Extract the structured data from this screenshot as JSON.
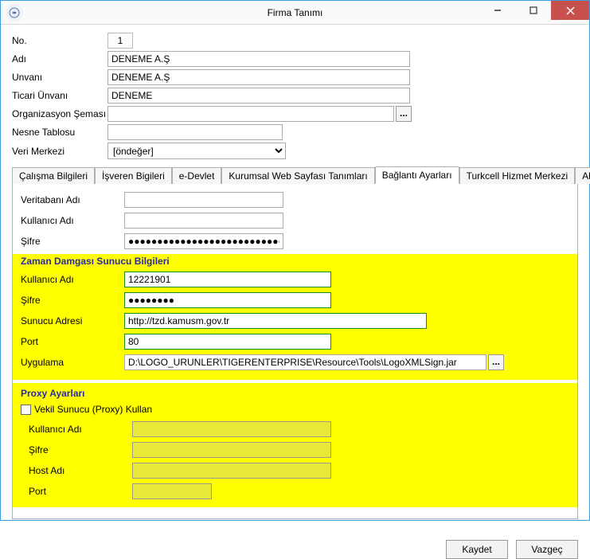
{
  "window": {
    "title": "Firma Tanımı"
  },
  "top": {
    "no_lbl": "No.",
    "no_val": "1",
    "adi_lbl": "Adı",
    "adi_val": "DENEME A.Ş",
    "unvani_lbl": "Unvanı",
    "unvani_val": "DENEME A.Ş",
    "ticari_lbl": "Ticari Ünvanı",
    "ticari_val": "DENEME",
    "org_lbl": "Organizasyon Şeması",
    "org_val": "",
    "nesne_lbl": "Nesne Tablosu",
    "nesne_val": "",
    "veri_lbl": "Veri Merkezi",
    "veri_val": "[öndeğer]"
  },
  "tabs": {
    "t0": "Çalışma Bilgileri",
    "t1": "İşveren Bigileri",
    "t2": "e-Devlet",
    "t3": "Kurumsal Web Sayfası Tanımları",
    "t4": "Bağlantı Ayarları",
    "t5": "Turkcell Hizmet Merkezi",
    "t6": "Akıllı Fax Ayarları"
  },
  "db": {
    "vt_lbl": "Veritabanı Adı",
    "vt_val": "",
    "ku_lbl": "Kullanıcı Adı",
    "ku_val": "",
    "sf_lbl": "Şifre",
    "sf_val": "●●●●●●●●●●●●●●●●●●●●●●●●●●●●●●●●"
  },
  "ts": {
    "title": "Zaman Damgası Sunucu Bilgileri",
    "ku_lbl": "Kullanıcı Adı",
    "ku_val": "12221901",
    "sf_lbl": "Şifre",
    "sf_val": "●●●●●●●●",
    "su_lbl": "Sunucu Adresi",
    "su_val": "http://tzd.kamusm.gov.tr",
    "port_lbl": "Port",
    "port_val": "80",
    "app_lbl": "Uygulama",
    "app_val": "D:\\LOGO_URUNLER\\TIGERENTERPRISE\\Resource\\Tools\\LogoXMLSign.jar"
  },
  "proxy": {
    "title": "Proxy Ayarları",
    "chk_lbl": "Vekil Sunucu (Proxy) Kullan",
    "ku_lbl": "Kullanıcı Adı",
    "sf_lbl": "Şifre",
    "host_lbl": "Host Adı",
    "port_lbl": "Port"
  },
  "buttons": {
    "save": "Kaydet",
    "cancel": "Vazgeç"
  },
  "colors": {
    "highlight": "#ffff00",
    "accent": "#1a8c1a"
  }
}
